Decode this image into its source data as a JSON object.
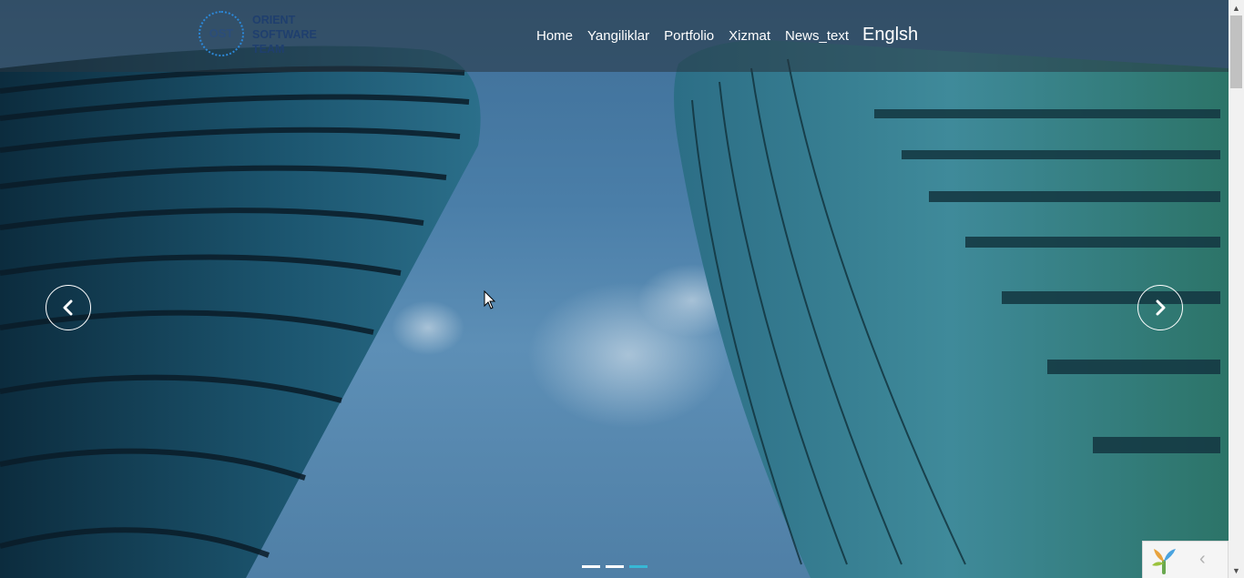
{
  "brand": {
    "abbr": "OST",
    "name_lines": [
      "ORIENT",
      "SOFTWARE",
      "TEAM"
    ]
  },
  "nav": {
    "items": [
      "Home",
      "Yangiliklar",
      "Portfolio",
      "Xizmat",
      "News_text"
    ],
    "language": "Englsh"
  },
  "carousel": {
    "slide_count": 3,
    "active_index": 2,
    "prev_icon": "chevron-left-icon",
    "next_icon": "chevron-right-icon"
  },
  "colors": {
    "indicator_active": "#37b8d6",
    "navbar_bg": "rgba(40,52,64,0.55)"
  }
}
